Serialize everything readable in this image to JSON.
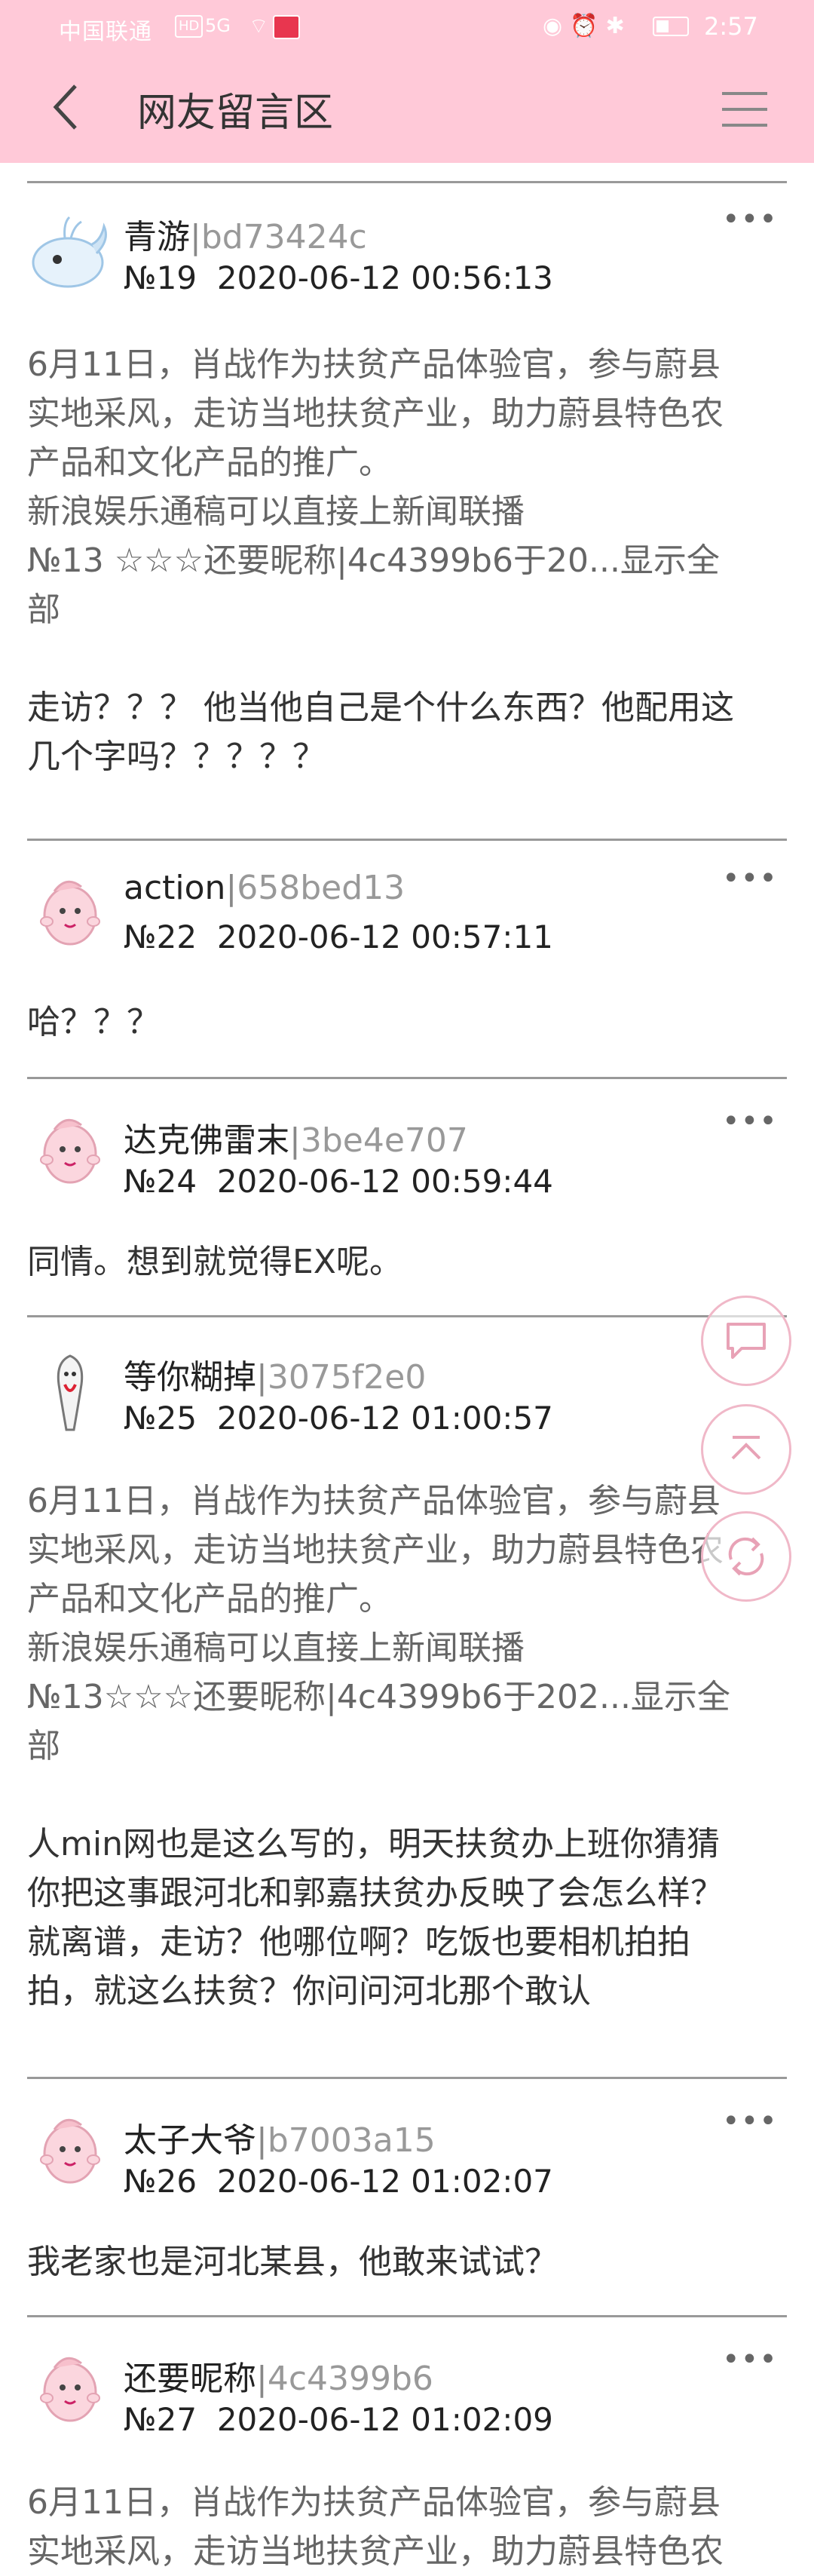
{
  "status_bar": {
    "carrier": "中国联通",
    "hd": "HD",
    "signal": "5G",
    "time": "2:57"
  },
  "header": {
    "title": "网友留言区"
  },
  "posts": [
    {
      "name": "青游",
      "hash": "bd73424c",
      "number": "№19",
      "time": "2020-06-12 00:56:13",
      "quote_lines": [
        "6月11日，肖战作为扶贫产品体验官，参与蔚县",
        "实地采风，走访当地扶贫产业，助力蔚县特色农",
        "产品和文化产品的推广。",
        "新浪娱乐通稿可以直接上新闻联播",
        "№13 ☆☆☆还要昵称|4c4399b6于20...显示全",
        "部"
      ],
      "reply_lines": [
        "走访？？？ 他当他自己是个什么东西？他配用这",
        "几个字吗？？？？？"
      ]
    },
    {
      "name": "action",
      "hash": "658bed13",
      "number": "№22",
      "time": "2020-06-12 00:57:11",
      "quote_lines": [],
      "reply_lines": [
        "哈？？？"
      ]
    },
    {
      "name": "达克佛雷末",
      "hash": "3be4e707",
      "number": "№24",
      "time": "2020-06-12 00:59:44",
      "quote_lines": [],
      "reply_lines": [
        "同情。想到就觉得EX呢。"
      ]
    },
    {
      "name": "等你糊掉",
      "hash": "3075f2e0",
      "number": "№25",
      "time": "2020-06-12 01:00:57",
      "quote_lines": [
        "6月11日，肖战作为扶贫产品体验官，参与蔚县",
        "实地采风，走访当地扶贫产业，助力蔚县特色农",
        "产品和文化产品的推广。",
        "新浪娱乐通稿可以直接上新闻联播",
        "№13☆☆☆还要昵称|4c4399b6于202...显示全",
        "部"
      ],
      "reply_lines": [
        "人min网也是这么写的，明天扶贫办上班你猜猜",
        "你把这事跟河北和郭嘉扶贫办反映了会怎么样？",
        "就离谱，走访？他哪位啊？吃饭也要相机拍拍",
        "拍，就这么扶贫？你问问河北那个敢认"
      ]
    },
    {
      "name": "太子大爷",
      "hash": "b7003a15",
      "number": "№26",
      "time": "2020-06-12 01:02:07",
      "quote_lines": [],
      "reply_lines": [
        "我老家也是河北某县，他敢来试试？"
      ]
    },
    {
      "name": "还要昵称",
      "hash": "4c4399b6",
      "number": "№27",
      "time": "2020-06-12 01:02:09",
      "quote_lines": [
        "6月11日，肖战作为扶贫产品体验官，参与蔚县",
        "实地采风，走访当地扶贫产业，助力蔚县特色农"
      ],
      "reply_lines": []
    }
  ],
  "icons": {
    "back": "chevron-left-icon",
    "menu": "hamburger-menu-icon",
    "more": "more-dots-icon",
    "comment": "comment-icon",
    "top": "back-to-top-icon",
    "refresh": "refresh-icon"
  },
  "colors": {
    "header_bg": "#ffc9d8",
    "accent": "#f0b8c8"
  }
}
